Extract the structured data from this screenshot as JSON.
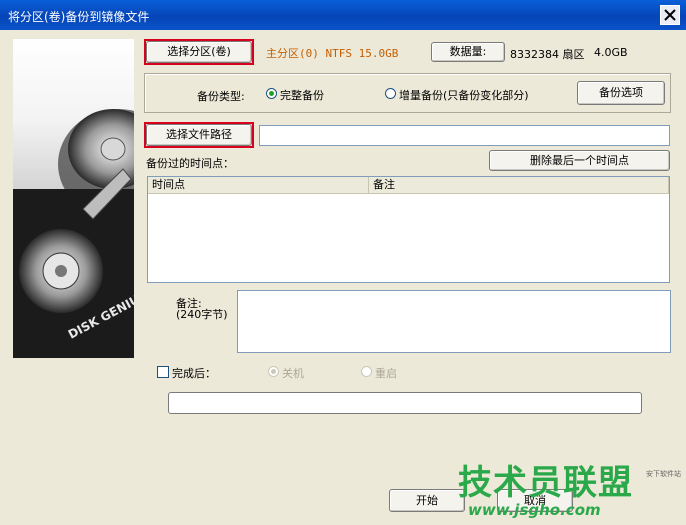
{
  "window": {
    "title": "将分区(卷)备份到镜像文件"
  },
  "partition": {
    "select_button": "选择分区(卷)",
    "selected_info": "主分区(0) NTFS 15.0GB",
    "data_button": "数据量:",
    "sectors": "8332384 扇区",
    "size": "4.0GB"
  },
  "backup_type": {
    "label": "备份类型:",
    "full": "完整备份",
    "incremental": "增量备份(只备份变化部分)",
    "options_button": "备份选项"
  },
  "file": {
    "select_button": "选择文件路径",
    "path_value": ""
  },
  "history": {
    "label": "备份过的时间点：",
    "delete_button": "删除最后一个时间点",
    "columns": [
      "时间点",
      "备注"
    ]
  },
  "note": {
    "label_line1": "备注:",
    "label_line2": "(240字节)"
  },
  "after": {
    "label": "完成后：",
    "shutdown": "关机",
    "restart": "重启"
  },
  "buttons": {
    "start": "开始",
    "cancel": "取消"
  },
  "brand": {
    "logo_text": "DISK GENIUS"
  },
  "watermark": {
    "title": "技术员联盟",
    "url": "www.jsgho.com",
    "small": "安下软件站"
  }
}
